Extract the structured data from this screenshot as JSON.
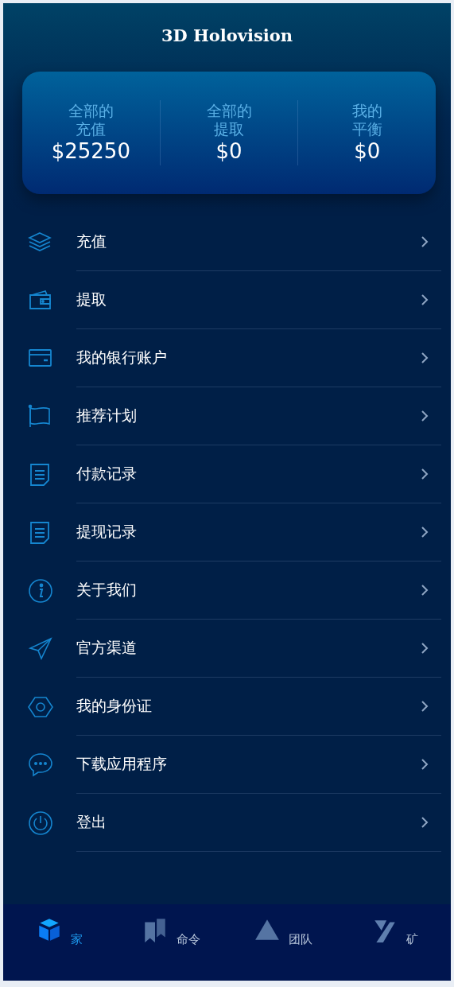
{
  "header": {
    "title": "3D Holovision"
  },
  "summary": [
    {
      "label_lines": [
        "全部的",
        "充值"
      ],
      "value": "$25250"
    },
    {
      "label_lines": [
        "全部的",
        "提取"
      ],
      "value": "$0"
    },
    {
      "label_lines": [
        "我的",
        "平衡"
      ],
      "value": "$0"
    }
  ],
  "menu": [
    {
      "label": "充值"
    },
    {
      "label": "提取"
    },
    {
      "label": "我的银行账户"
    },
    {
      "label": "推荐计划"
    },
    {
      "label": "付款记录"
    },
    {
      "label": "提现记录"
    },
    {
      "label": "关于我们"
    },
    {
      "label": "官方渠道"
    },
    {
      "label": "我的身份证"
    },
    {
      "label": "下载应用程序"
    },
    {
      "label": "登出"
    }
  ],
  "bottom_nav": [
    {
      "label": "家",
      "selected": true
    },
    {
      "label": "命令",
      "selected": false
    },
    {
      "label": "团队",
      "selected": false
    },
    {
      "label": "矿",
      "selected": false
    }
  ]
}
